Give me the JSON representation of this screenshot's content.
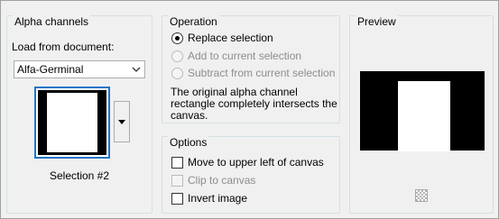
{
  "alpha_channels": {
    "title": "Alpha channels",
    "load_label": "Load from document:",
    "document_value": "Alfa-Germinal",
    "selection_name": "Selection #2"
  },
  "operation": {
    "title": "Operation",
    "options": [
      {
        "label": "Replace selection",
        "checked": true,
        "enabled": true
      },
      {
        "label": "Add to current selection",
        "checked": false,
        "enabled": false
      },
      {
        "label": "Subtract from current selection",
        "checked": false,
        "enabled": false
      }
    ],
    "description": "The original alpha channel rectangle completely intersects the canvas."
  },
  "options": {
    "title": "Options",
    "items": [
      {
        "label": "Move to upper left of canvas",
        "checked": false,
        "enabled": true
      },
      {
        "label": "Clip to canvas",
        "checked": false,
        "enabled": false
      },
      {
        "label": "Invert image",
        "checked": false,
        "enabled": true
      }
    ]
  },
  "preview": {
    "title": "Preview"
  },
  "icons": {
    "combo_arrow": "chevron-down-icon",
    "thumb_dropdown": "triangle-down-icon",
    "checker": "checkerboard-icon"
  }
}
